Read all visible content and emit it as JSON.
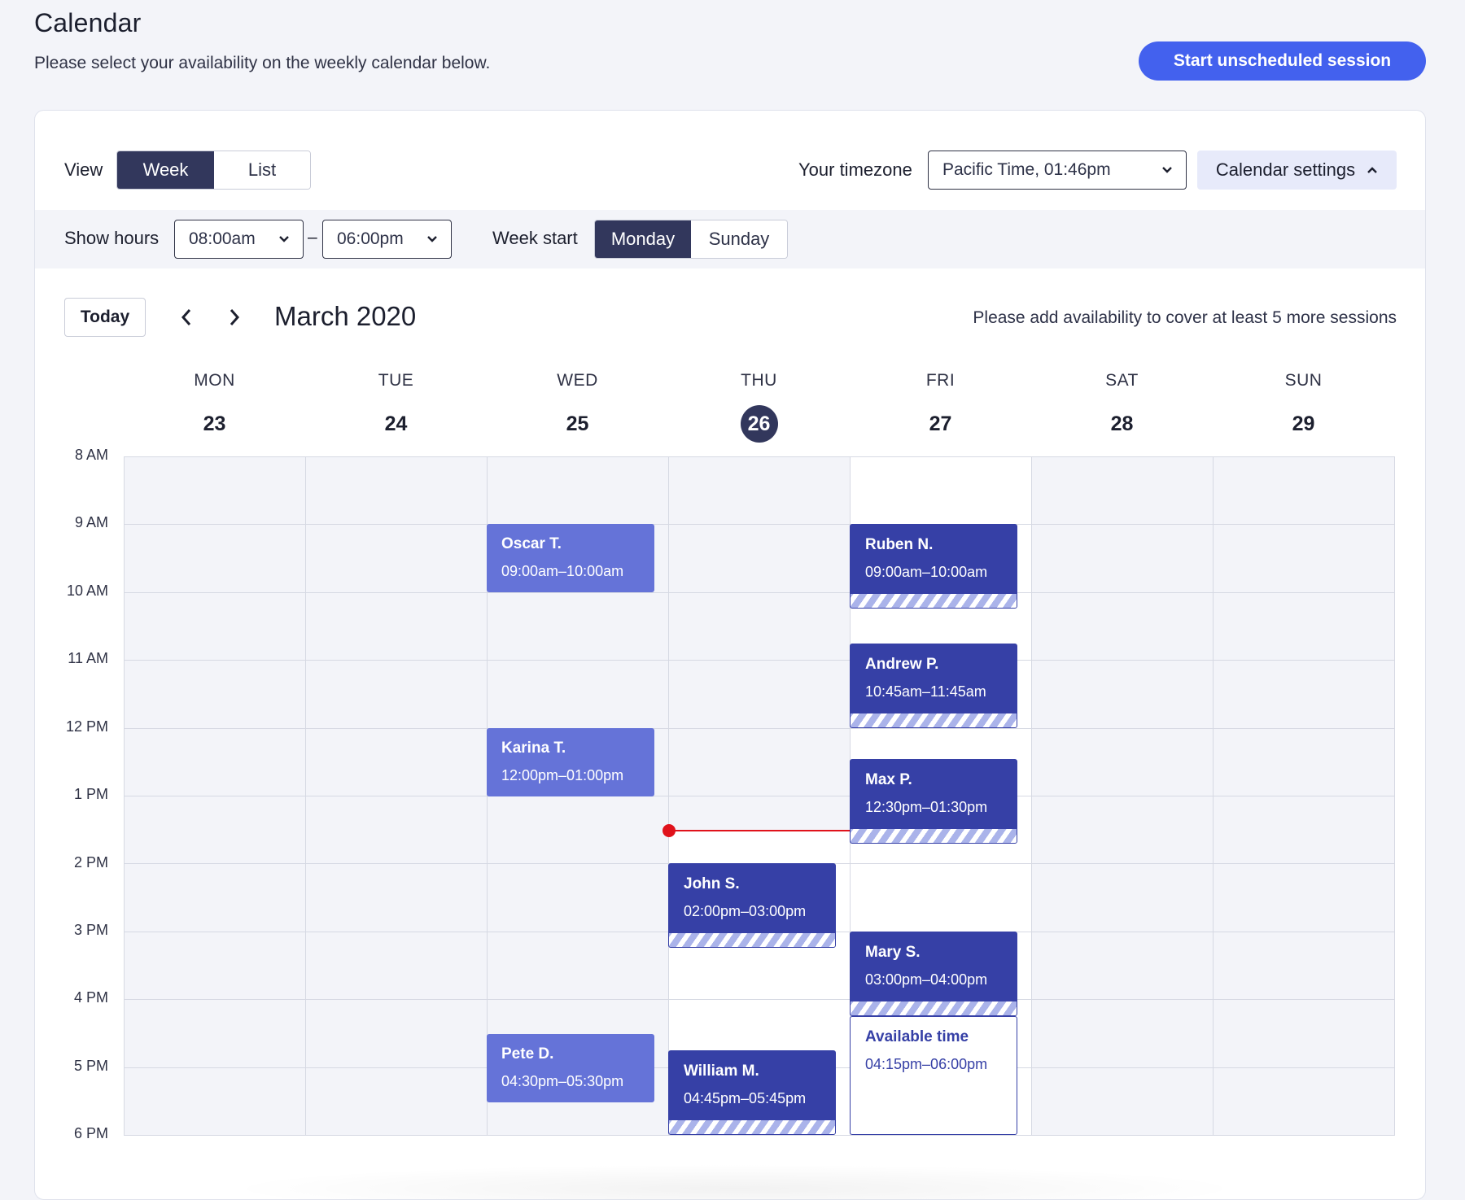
{
  "header": {
    "title": "Calendar",
    "subtitle": "Please select your availability on the weekly calendar below.",
    "start_button": "Start unscheduled session"
  },
  "toolbar": {
    "view_label": "View",
    "view_options": [
      "Week",
      "List"
    ],
    "view_selected": "Week",
    "timezone_label": "Your timezone",
    "timezone_value": "Pacific Time, 01:46pm",
    "settings_button": "Calendar settings"
  },
  "settings": {
    "show_hours_label": "Show hours",
    "hours_from": "08:00am",
    "hours_separator": "–",
    "hours_to": "06:00pm",
    "week_start_label": "Week start",
    "week_start_options": [
      "Monday",
      "Sunday"
    ],
    "week_start_selected": "Monday"
  },
  "calendar_nav": {
    "today_button": "Today",
    "month": "March 2020",
    "notice": "Please add availability to cover at least 5 more sessions"
  },
  "days": [
    {
      "dow": "MON",
      "date": "23"
    },
    {
      "dow": "TUE",
      "date": "24"
    },
    {
      "dow": "WED",
      "date": "25"
    },
    {
      "dow": "THU",
      "date": "26"
    },
    {
      "dow": "FRI",
      "date": "27"
    },
    {
      "dow": "SAT",
      "date": "28"
    },
    {
      "dow": "SUN",
      "date": "29"
    }
  ],
  "today_date": "26",
  "hours": [
    "8 AM",
    "9 AM",
    "10 AM",
    "11 AM",
    "12 PM",
    "1 PM",
    "2 PM",
    "3 PM",
    "4 PM",
    "5 PM",
    "6 PM"
  ],
  "events": [
    {
      "name": "Oscar T.",
      "time": "09:00am–10:00am",
      "day": "WED",
      "style": "light"
    },
    {
      "name": "Karina T.",
      "time": "12:00pm–01:00pm",
      "day": "WED",
      "style": "light"
    },
    {
      "name": "Pete D.",
      "time": "04:30pm–05:30pm",
      "day": "WED",
      "style": "light"
    },
    {
      "name": "John S.",
      "time": "02:00pm–03:00pm",
      "day": "THU",
      "style": "dark"
    },
    {
      "name": "William M.",
      "time": "04:45pm–05:45pm",
      "day": "THU",
      "style": "dark"
    },
    {
      "name": "Ruben N.",
      "time": "09:00am–10:00am",
      "day": "FRI",
      "style": "dark"
    },
    {
      "name": "Andrew P.",
      "time": "10:45am–11:45am",
      "day": "FRI",
      "style": "dark"
    },
    {
      "name": "Max P.",
      "time": "12:30pm–01:30pm",
      "day": "FRI",
      "style": "dark"
    },
    {
      "name": "Mary S.",
      "time": "03:00pm–04:00pm",
      "day": "FRI",
      "style": "dark"
    },
    {
      "name": "Available time",
      "time": "04:15pm–06:00pm",
      "day": "FRI",
      "style": "available"
    }
  ],
  "colors": {
    "accent": "#4361ee",
    "dark_navy": "#32375c",
    "session_dark": "#3640a6",
    "session_light": "#6573d8",
    "now_indicator": "#e0121b"
  },
  "icons": [
    "chevron-down-icon",
    "chevron-up-icon",
    "chevron-left-icon",
    "chevron-right-icon"
  ]
}
